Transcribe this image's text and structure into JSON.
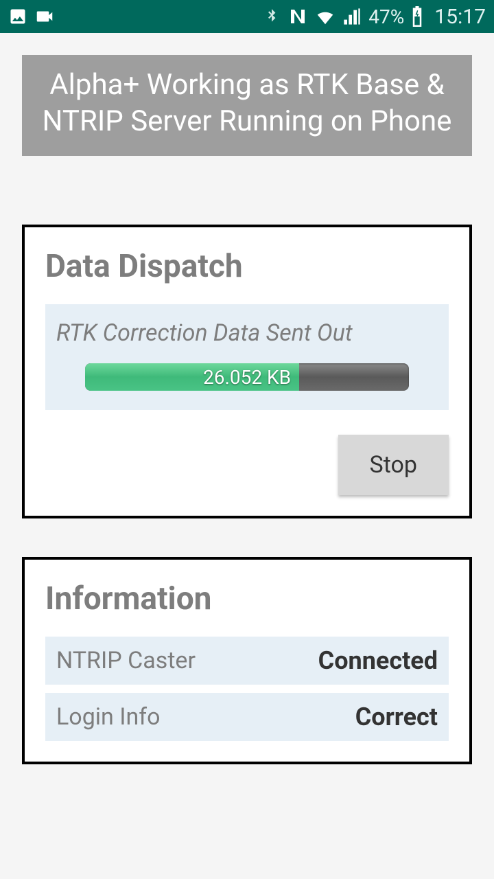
{
  "statusbar": {
    "battery_pct": "47%",
    "time": "15:17"
  },
  "banner": {
    "title": "Alpha+ Working as RTK Base & NTRIP Server Running on Phone"
  },
  "dispatch": {
    "heading": "Data Dispatch",
    "subtitle": "RTK Correction Data Sent Out",
    "progress_label": "26.052 KB",
    "progress_pct": 66,
    "stop_label": "Stop"
  },
  "info": {
    "heading": "Information",
    "rows": [
      {
        "label": "NTRIP Caster",
        "value": "Connected"
      },
      {
        "label": "Login Info",
        "value": "Correct"
      }
    ]
  }
}
